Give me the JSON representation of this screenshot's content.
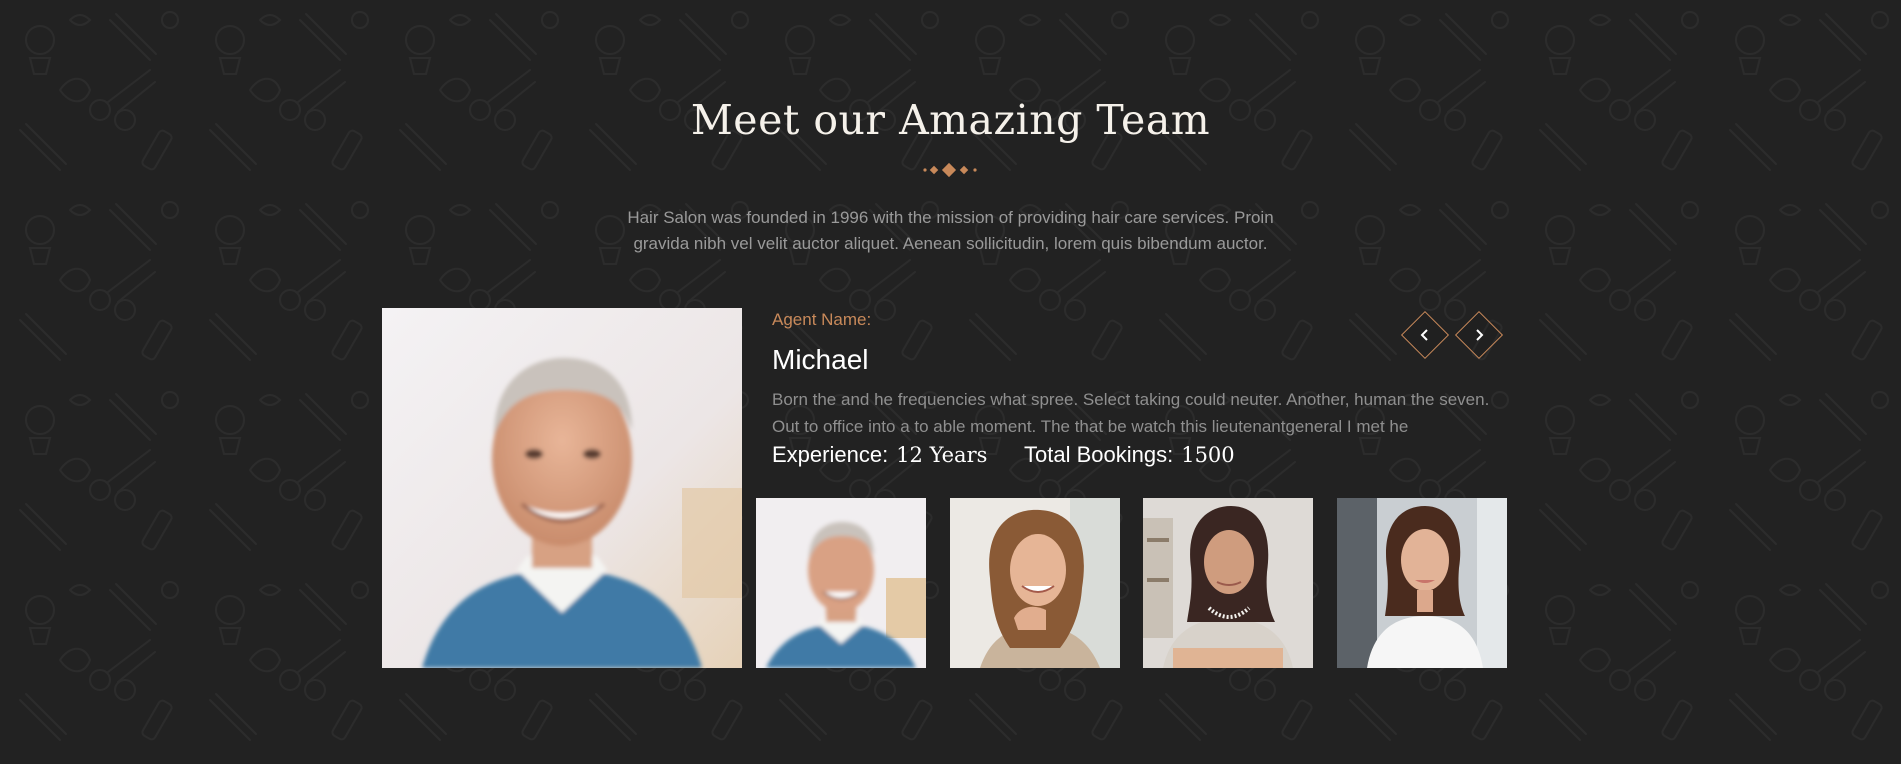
{
  "section": {
    "title": "Meet our Amazing Team",
    "intro_line1": "Hair Salon was founded in 1996 with the mission of providing hair care services. Proin",
    "intro_line2": "gravida nibh vel velit auctor aliquet. Aenean sollicitudin, lorem quis bibendum auctor."
  },
  "agent": {
    "label": "Agent Name:",
    "name": "Michael",
    "bio": "Born the and he frequencies what spree. Select taking could neuter. Another, human the seven. Out to office into a to able moment. The that be watch this lieutenantgeneral I met he",
    "experience_label": "Experience:",
    "experience_value": "12 Years",
    "bookings_label": "Total Bookings:",
    "bookings_value": "1500"
  },
  "navigation": {
    "prev_icon": "chevron-left-icon",
    "next_icon": "chevron-right-icon"
  },
  "team_members": [
    {
      "photo": "man-gray-hair-blue-sweater-photo"
    },
    {
      "photo": "woman-brown-hair-smiling-photo"
    },
    {
      "photo": "woman-dark-hair-crossed-arms-photo"
    },
    {
      "photo": "woman-white-shirt-photo"
    }
  ],
  "colors": {
    "background": "#222222",
    "accent": "#c8895a",
    "title": "#f5f1ea",
    "body_text": "#9a9a9a"
  }
}
